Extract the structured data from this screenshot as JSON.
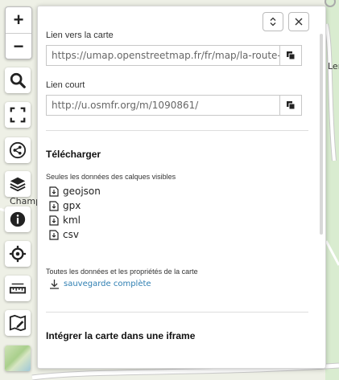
{
  "map": {
    "labels": [
      "Champ",
      "Ler"
    ]
  },
  "zoom": {
    "in_label": "+",
    "out_label": "−"
  },
  "controls": [
    "search-icon",
    "fullscreen-icon",
    "share-icon",
    "layers-icon",
    "info-icon",
    "locate-icon",
    "measure-icon",
    "edit-map-icon"
  ],
  "panel": {
    "map_link_label": "Lien vers la carte",
    "map_link_value": "https://umap.openstreetmap.fr/fr/map/la-route-des",
    "short_link_label": "Lien court",
    "short_link_value": "http://u.osmfr.org/m/1090861/",
    "download_title": "Télécharger",
    "visible_layers_note": "Seules les données des calques visibles",
    "formats": [
      "geojson",
      "gpx",
      "kml",
      "csv"
    ],
    "all_data_note": "Toutes les données et les propriétés de la carte",
    "full_backup_label": "sauvegarde complète",
    "iframe_title": "Intégrer la carte dans une iframe"
  },
  "colors": {
    "link": "#2f7fb2",
    "map_bg": "#eef0e6"
  }
}
